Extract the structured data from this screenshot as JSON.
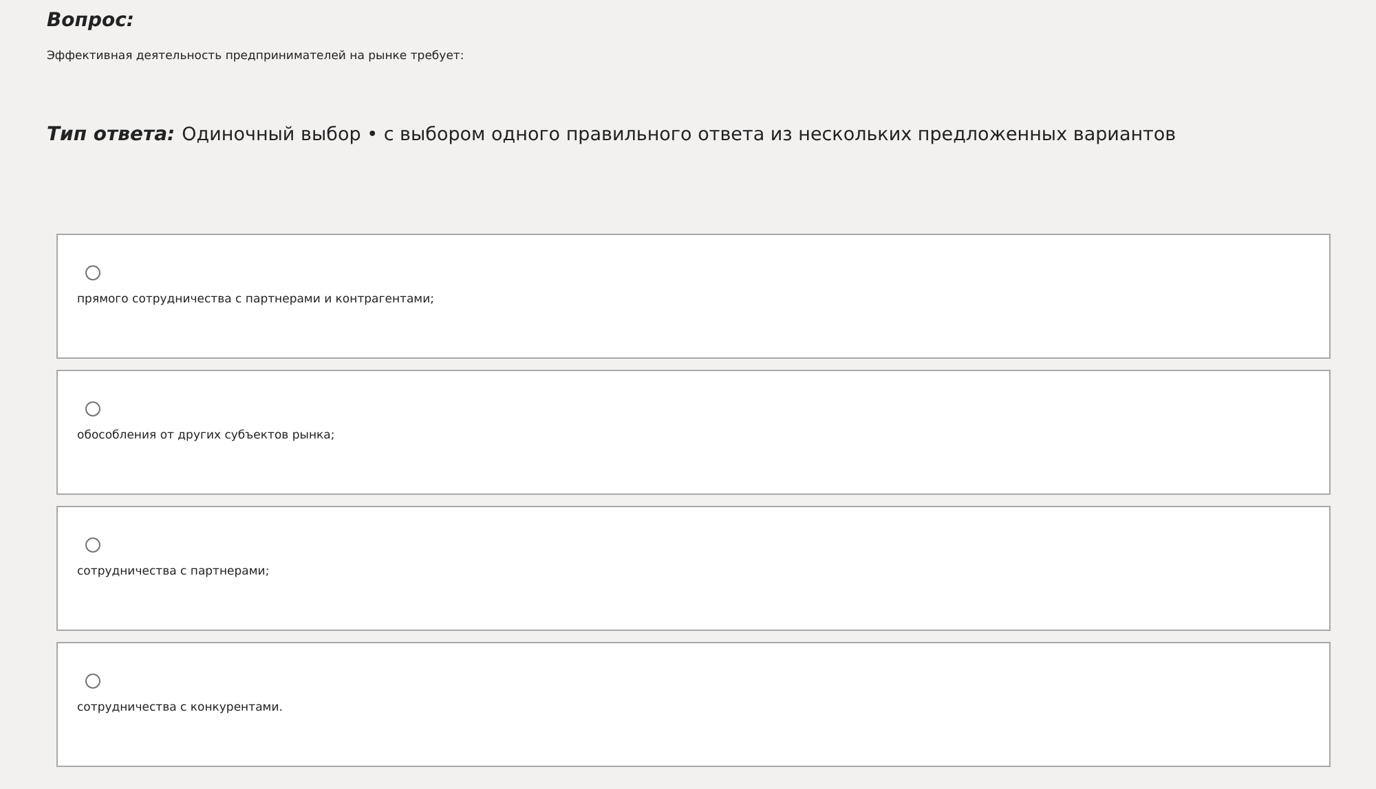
{
  "question": {
    "heading": "Вопрос:",
    "text": "Эффективная деятельность предпринимателей на рынке требует:"
  },
  "answer_type": {
    "label": "Тип ответа:",
    "value": "Одиночный выбор • с выбором одного правильного ответа из нескольких предложенных вариантов"
  },
  "options": [
    {
      "label": "прямого сотрудничества с партнерами и контрагентами;",
      "selected": false
    },
    {
      "label": "обособления от других субъектов рынка;",
      "selected": false
    },
    {
      "label": "сотрудничества с партнерами;",
      "selected": false
    },
    {
      "label": "сотрудничества с конкурентами.",
      "selected": false
    }
  ]
}
